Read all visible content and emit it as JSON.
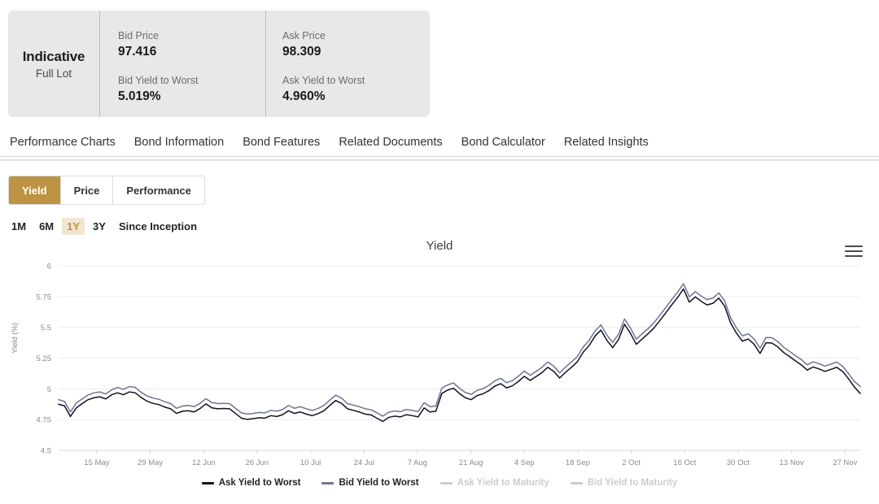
{
  "quote_panel": {
    "label_main": "Indicative",
    "label_sub": "Full Lot",
    "left_column": [
      {
        "name": "Bid Price",
        "value": "97.416"
      },
      {
        "name": "Bid Yield to Worst",
        "value": "5.019%"
      }
    ],
    "right_column": [
      {
        "name": "Ask Price",
        "value": "98.309"
      },
      {
        "name": "Ask Yield to Worst",
        "value": "4.960%"
      }
    ]
  },
  "nav_tabs": [
    {
      "label": "Performance Charts",
      "active": true
    },
    {
      "label": "Bond Information",
      "active": false
    },
    {
      "label": "Bond Features",
      "active": false
    },
    {
      "label": "Related Documents",
      "active": false
    },
    {
      "label": "Bond Calculator",
      "active": false
    },
    {
      "label": "Related Insights",
      "active": false
    }
  ],
  "chart_mode_tabs": [
    {
      "label": "Yield",
      "active": true
    },
    {
      "label": "Price",
      "active": false
    },
    {
      "label": "Performance",
      "active": false
    }
  ],
  "period_tabs": [
    {
      "label": "1M",
      "active": false
    },
    {
      "label": "6M",
      "active": false
    },
    {
      "label": "1Y",
      "active": true
    },
    {
      "label": "3Y",
      "active": false
    },
    {
      "label": "Since Inception",
      "active": false
    }
  ],
  "chart_menu": {
    "icon": "hamburger-menu-icon"
  },
  "colors": {
    "accent_gold": "#bc9444",
    "accent_gold_light": "#f2e6d2",
    "ask_line": "#12121e",
    "bid_line": "#6f7396",
    "disabled": "#cccccc",
    "grid": "#ededed"
  },
  "chart_data": {
    "type": "line",
    "title": "Yield",
    "xlabel": "",
    "ylabel": "Yield (%)",
    "ylim": [
      4.5,
      6.0
    ],
    "yticks": [
      4.5,
      4.75,
      5,
      5.25,
      5.5,
      5.75,
      6
    ],
    "ytick_labels": [
      "4.5",
      "4.75",
      "5",
      "5.25",
      "5.5",
      "5.75",
      "6"
    ],
    "xtick_labels": [
      "15 May",
      "29 May",
      "12 Jun",
      "26 Jun",
      "10 Jul",
      "24 Jul",
      "7 Aug",
      "21 Aug",
      "4 Sep",
      "18 Sep",
      "2 Oct",
      "16 Oct",
      "30 Oct",
      "13 Nov",
      "27 Nov"
    ],
    "xtick_positions": [
      0.0476,
      0.1143,
      0.181,
      0.2476,
      0.3143,
      0.381,
      0.4476,
      0.5143,
      0.581,
      0.6476,
      0.7143,
      0.781,
      0.8476,
      0.9143,
      0.981
    ],
    "grid": true,
    "legend_position": "bottom",
    "series": [
      {
        "name": "Ask Yield to Worst",
        "color": "#12121e",
        "visible": true,
        "values": [
          4.875,
          4.862,
          4.775,
          4.845,
          4.88,
          4.912,
          4.928,
          4.935,
          4.918,
          4.952,
          4.968,
          4.952,
          4.975,
          4.968,
          4.93,
          4.9,
          4.882,
          4.872,
          4.852,
          4.838,
          4.8,
          4.818,
          4.822,
          4.812,
          4.84,
          4.878,
          4.845,
          4.838,
          4.84,
          4.838,
          4.8,
          4.762,
          4.752,
          4.758,
          4.765,
          4.762,
          4.782,
          4.775,
          4.79,
          4.822,
          4.8,
          4.812,
          4.795,
          4.782,
          4.798,
          4.822,
          4.865,
          4.905,
          4.882,
          4.838,
          4.825,
          4.812,
          4.795,
          4.788,
          4.762,
          4.735,
          4.768,
          4.778,
          4.772,
          4.79,
          4.782,
          4.772,
          4.845,
          4.812,
          4.818,
          4.962,
          4.99,
          5.005,
          4.962,
          4.928,
          4.912,
          4.945,
          4.96,
          4.985,
          5.022,
          5.042,
          5.008,
          5.025,
          5.06,
          5.102,
          5.068,
          5.1,
          5.132,
          5.175,
          5.142,
          5.088,
          5.135,
          5.175,
          5.22,
          5.298,
          5.352,
          5.428,
          5.478,
          5.395,
          5.335,
          5.402,
          5.525,
          5.452,
          5.362,
          5.405,
          5.448,
          5.495,
          5.555,
          5.618,
          5.682,
          5.742,
          5.812,
          5.705,
          5.748,
          5.712,
          5.682,
          5.695,
          5.738,
          5.672,
          5.535,
          5.452,
          5.388,
          5.405,
          5.362,
          5.288,
          5.375,
          5.372,
          5.342,
          5.295,
          5.262,
          5.228,
          5.195,
          5.152,
          5.178,
          5.162,
          5.142,
          5.158,
          5.175,
          5.142,
          5.082,
          5.015,
          4.962
        ],
        "first_value": 4.875,
        "last_value": 4.96,
        "min": 4.735,
        "max": 5.812
      },
      {
        "name": "Bid Yield to Worst",
        "color": "#6f7396",
        "visible": true,
        "values": [
          4.912,
          4.898,
          4.812,
          4.885,
          4.918,
          4.95,
          4.968,
          4.975,
          4.958,
          4.992,
          5.012,
          4.995,
          5.018,
          5.012,
          4.972,
          4.942,
          4.925,
          4.915,
          4.895,
          4.88,
          4.842,
          4.86,
          4.865,
          4.855,
          4.882,
          4.92,
          4.888,
          4.88,
          4.882,
          4.88,
          4.842,
          4.805,
          4.795,
          4.8,
          4.808,
          4.805,
          4.825,
          4.818,
          4.832,
          4.865,
          4.842,
          4.855,
          4.838,
          4.825,
          4.84,
          4.865,
          4.908,
          4.948,
          4.925,
          4.88,
          4.868,
          4.855,
          4.838,
          4.83,
          4.805,
          4.778,
          4.81,
          4.82,
          4.815,
          4.832,
          4.825,
          4.815,
          4.888,
          4.855,
          4.86,
          5.005,
          5.032,
          5.048,
          5.005,
          4.97,
          4.955,
          4.988,
          5.002,
          5.028,
          5.065,
          5.085,
          5.05,
          5.068,
          5.102,
          5.145,
          5.11,
          5.142,
          5.175,
          5.218,
          5.185,
          5.13,
          5.178,
          5.218,
          5.262,
          5.34,
          5.395,
          5.47,
          5.52,
          5.438,
          5.378,
          5.445,
          5.568,
          5.495,
          5.405,
          5.448,
          5.49,
          5.538,
          5.598,
          5.66,
          5.725,
          5.785,
          5.855,
          5.748,
          5.79,
          5.755,
          5.725,
          5.738,
          5.78,
          5.715,
          5.578,
          5.495,
          5.43,
          5.448,
          5.405,
          5.33,
          5.418,
          5.415,
          5.385,
          5.338,
          5.305,
          5.27,
          5.238,
          5.195,
          5.22,
          5.205,
          5.185,
          5.2,
          5.218,
          5.185,
          5.125,
          5.06,
          5.019
        ],
        "first_value": 4.912,
        "last_value": 5.019,
        "min": 4.778,
        "max": 5.855
      },
      {
        "name": "Ask Yield to Maturity",
        "color": "#cccccc",
        "visible": false,
        "values": []
      },
      {
        "name": "Bid Yield to Maturity",
        "color": "#cccccc",
        "visible": false,
        "values": []
      }
    ]
  }
}
